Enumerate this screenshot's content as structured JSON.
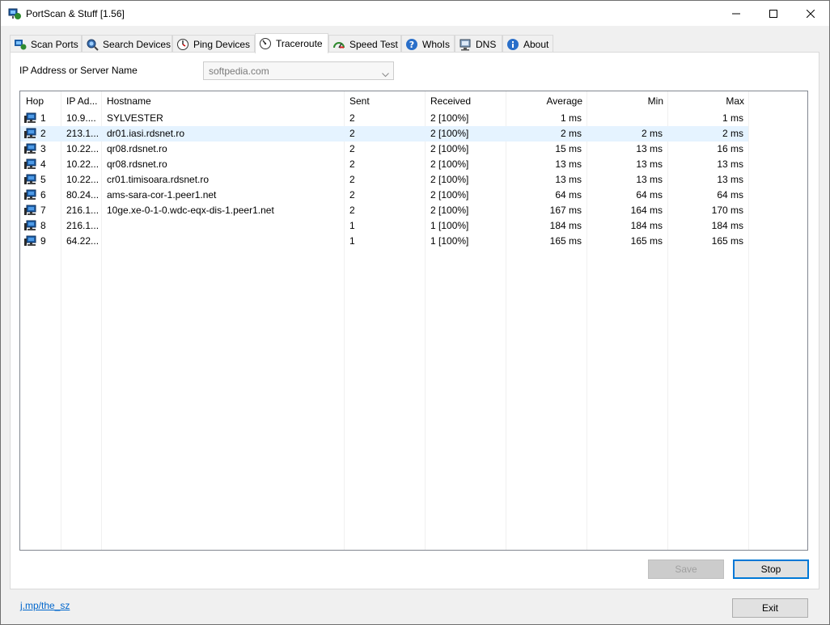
{
  "window": {
    "title": "PortScan & Stuff [1.56]"
  },
  "tabs": [
    {
      "label": "Scan Ports",
      "icon": "scan-ports-icon"
    },
    {
      "label": "Search Devices",
      "icon": "search-devices-icon"
    },
    {
      "label": "Ping Devices",
      "icon": "ping-icon"
    },
    {
      "label": "Traceroute",
      "icon": "traceroute-icon",
      "active": true
    },
    {
      "label": "Speed Test",
      "icon": "speedometer-icon"
    },
    {
      "label": "WhoIs",
      "icon": "whois-icon"
    },
    {
      "label": "DNS",
      "icon": "dns-icon"
    },
    {
      "label": "About",
      "icon": "info-icon"
    }
  ],
  "target": {
    "label": "IP Address or Server Name",
    "value": "softpedia.com"
  },
  "table": {
    "columns": [
      "Hop",
      "IP Ad...",
      "Hostname",
      "Sent",
      "Received",
      "Average",
      "Min",
      "Max"
    ],
    "rows": [
      {
        "hop": "1",
        "ip": "10.9....",
        "host": "SYLVESTER",
        "sent": "2",
        "received": "2 [100%]",
        "avg": "1 ms",
        "min": "",
        "max": "1 ms"
      },
      {
        "hop": "2",
        "ip": "213.1...",
        "host": "dr01.iasi.rdsnet.ro",
        "sent": "2",
        "received": "2 [100%]",
        "avg": "2 ms",
        "min": "2 ms",
        "max": "2 ms",
        "selected": true
      },
      {
        "hop": "3",
        "ip": "10.22...",
        "host": "qr08.rdsnet.ro",
        "sent": "2",
        "received": "2 [100%]",
        "avg": "15 ms",
        "min": "13 ms",
        "max": "16 ms"
      },
      {
        "hop": "4",
        "ip": "10.22...",
        "host": "qr08.rdsnet.ro",
        "sent": "2",
        "received": "2 [100%]",
        "avg": "13 ms",
        "min": "13 ms",
        "max": "13 ms"
      },
      {
        "hop": "5",
        "ip": "10.22...",
        "host": "cr01.timisoara.rdsnet.ro",
        "sent": "2",
        "received": "2 [100%]",
        "avg": "13 ms",
        "min": "13 ms",
        "max": "13 ms"
      },
      {
        "hop": "6",
        "ip": "80.24...",
        "host": "ams-sara-cor-1.peer1.net",
        "sent": "2",
        "received": "2 [100%]",
        "avg": "64 ms",
        "min": "64 ms",
        "max": "64 ms"
      },
      {
        "hop": "7",
        "ip": "216.1...",
        "host": "10ge.xe-0-1-0.wdc-eqx-dis-1.peer1.net",
        "sent": "2",
        "received": "2 [100%]",
        "avg": "167 ms",
        "min": "164 ms",
        "max": "170 ms"
      },
      {
        "hop": "8",
        "ip": "216.1...",
        "host": "",
        "sent": "1",
        "received": "1 [100%]",
        "avg": "184 ms",
        "min": "184 ms",
        "max": "184 ms"
      },
      {
        "hop": "9",
        "ip": "64.22...",
        "host": "",
        "sent": "1",
        "received": "1 [100%]",
        "avg": "165 ms",
        "min": "165 ms",
        "max": "165 ms"
      }
    ]
  },
  "buttons": {
    "save": "Save",
    "stop": "Stop",
    "exit": "Exit"
  },
  "footer": {
    "link": "j.mp/the_sz"
  },
  "colors": {
    "selection": "#e5f3ff",
    "accent": "#0078d7",
    "link": "#0066cc"
  }
}
